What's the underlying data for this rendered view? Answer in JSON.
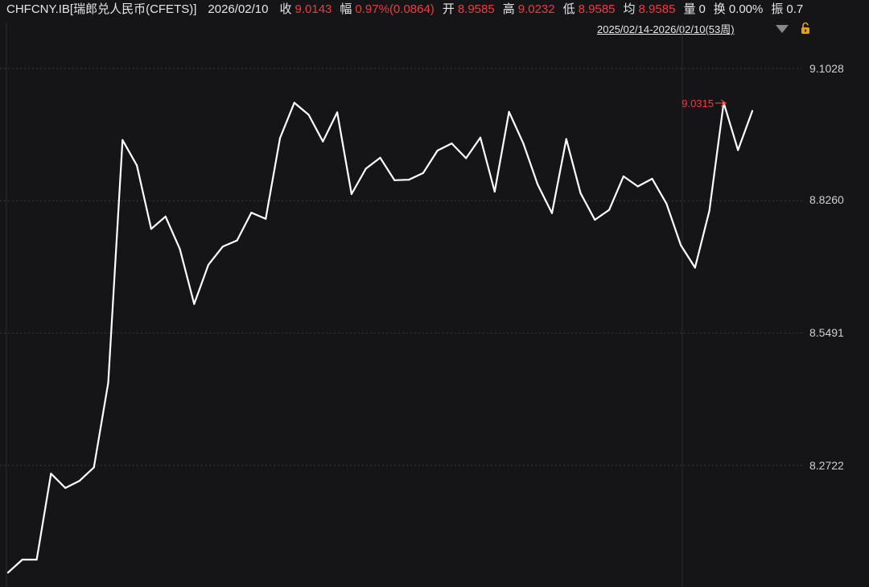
{
  "header": {
    "title": "CHFCNY.IB[瑞郎兑人民币(CFETS)]",
    "date": "2026/02/10",
    "close_label": "收",
    "close_value": "9.0143",
    "change_label": "幅",
    "change_value": "0.97%(0.0864)",
    "open_label": "开",
    "open_value": "8.9585",
    "high_label": "高",
    "high_value": "9.0232",
    "low_label": "低",
    "low_value": "8.9585",
    "avg_label": "均",
    "avg_value": "8.9585",
    "volume_label": "量",
    "volume_value": "0",
    "turnover_label": "换",
    "turnover_value": "0.00%",
    "amplitude_label": "振",
    "amplitude_value": "0.7"
  },
  "range_selector": {
    "label": "2025/02/14-2026/02/10(53周)"
  },
  "colors": {
    "background": "#151518",
    "line": "#ffffff",
    "accent_red": "#f23b3b",
    "grid": "#3a3a3e",
    "lock": "#e0a020"
  },
  "icons": {
    "dropdown": "triangle-down-icon",
    "lock": "lock-icon"
  },
  "chart_data": {
    "type": "line",
    "y_ticks": [
      "9.1028",
      "8.8260",
      "8.5491",
      "8.2722"
    ],
    "ylim": [
      8.05,
      9.18
    ],
    "max_annotation": "9.0315",
    "grid": true,
    "series": [
      {
        "values": [
          8.048,
          8.075,
          8.075,
          8.255,
          8.225,
          8.24,
          8.268,
          8.445,
          8.953,
          8.9,
          8.767,
          8.793,
          8.725,
          8.61,
          8.692,
          8.73,
          8.743,
          8.801,
          8.788,
          8.957,
          9.031,
          9.006,
          8.95,
          9.011,
          8.84,
          8.893,
          8.916,
          8.869,
          8.87,
          8.884,
          8.931,
          8.946,
          8.915,
          8.958,
          8.845,
          9.012,
          8.946,
          8.86,
          8.8,
          8.955,
          8.842,
          8.786,
          8.807,
          8.877,
          8.856,
          8.872,
          8.82,
          8.733,
          8.686,
          8.805,
          9.031,
          8.932,
          9.014
        ]
      }
    ]
  }
}
